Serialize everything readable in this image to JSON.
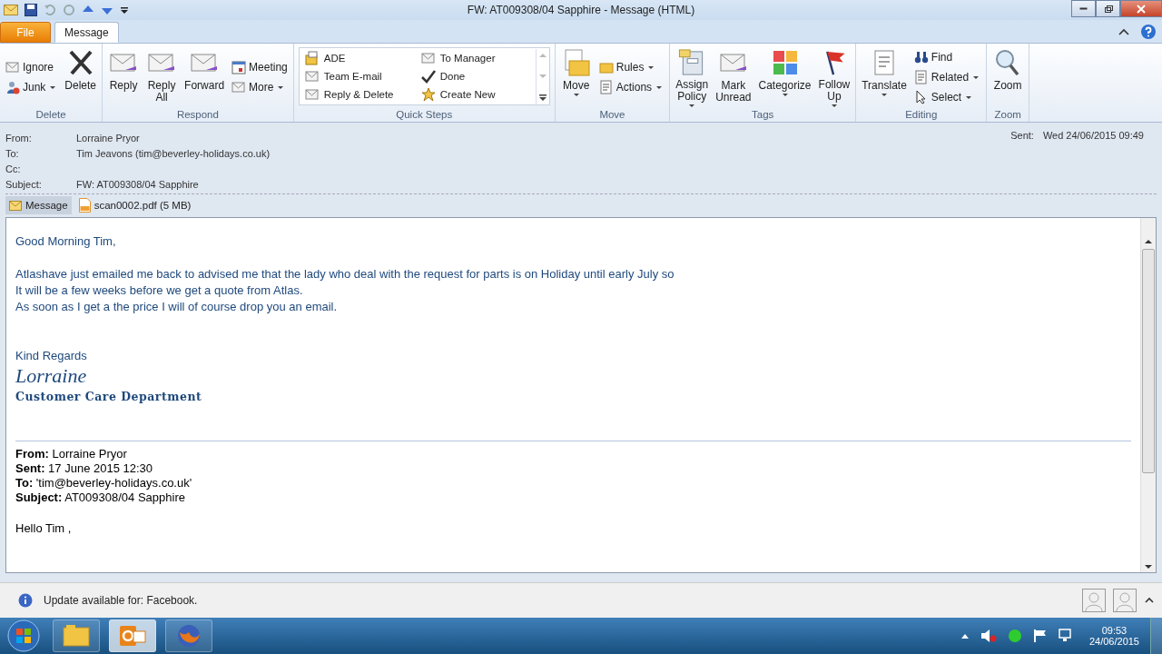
{
  "window": {
    "title": "FW: AT009308/04 Sapphire  -  Message (HTML)"
  },
  "tabs": [
    {
      "label": "File",
      "kind": "file",
      "selected": false
    },
    {
      "label": "Message",
      "kind": "tab",
      "selected": true
    }
  ],
  "ribbon": [
    {
      "name": "Delete",
      "columns": [
        [
          {
            "kind": "small",
            "label": "Ignore",
            "dropdown": false
          },
          {
            "kind": "small",
            "label": "Junk",
            "dropdown": true
          }
        ],
        [
          {
            "kind": "large",
            "label": "Delete",
            "dropdown": false
          }
        ]
      ]
    },
    {
      "name": "Respond",
      "columns": [
        [
          {
            "kind": "large",
            "label": "Reply",
            "dropdown": false
          }
        ],
        [
          {
            "kind": "large",
            "label": "Reply All",
            "dropdown": false
          }
        ],
        [
          {
            "kind": "large",
            "label": "Forward",
            "dropdown": false
          }
        ],
        [
          {
            "kind": "small",
            "label": "Meeting",
            "dropdown": false
          },
          {
            "kind": "small",
            "label": "More",
            "dropdown": true
          }
        ]
      ]
    },
    {
      "name": "Quick Steps",
      "columns": [
        [
          {
            "kind": "gallery",
            "label": "ADE"
          },
          {
            "kind": "gallery",
            "label": "Team E-mail"
          },
          {
            "kind": "gallery",
            "label": "Reply & Delete"
          }
        ],
        [
          {
            "kind": "gallery",
            "label": "To Manager"
          },
          {
            "kind": "gallery",
            "label": "Done"
          },
          {
            "kind": "gallery",
            "label": "Create New"
          }
        ]
      ]
    },
    {
      "name": "Move",
      "columns": [
        [
          {
            "kind": "large",
            "label": "Move",
            "dropdown": true
          }
        ],
        [
          {
            "kind": "small",
            "label": "Rules",
            "dropdown": true
          },
          {
            "kind": "small",
            "label": "Actions",
            "dropdown": true
          }
        ]
      ]
    },
    {
      "name": "Tags",
      "columns": [
        [
          {
            "kind": "large",
            "label": "Assign Policy",
            "dropdown": true
          }
        ],
        [
          {
            "kind": "large",
            "label": "Mark Unread",
            "dropdown": false
          }
        ],
        [
          {
            "kind": "large",
            "label": "Categorize",
            "dropdown": true
          }
        ],
        [
          {
            "kind": "large",
            "label": "Follow Up",
            "dropdown": true
          }
        ]
      ]
    },
    {
      "name": "Editing",
      "columns": [
        [
          {
            "kind": "large",
            "label": "Translate",
            "dropdown": true
          }
        ],
        [
          {
            "kind": "small",
            "label": "Find",
            "dropdown": false
          },
          {
            "kind": "small",
            "label": "Related",
            "dropdown": true
          },
          {
            "kind": "small",
            "label": "Select",
            "dropdown": true
          }
        ]
      ]
    },
    {
      "name": "Zoom",
      "columns": [
        [
          {
            "kind": "large",
            "label": "Zoom",
            "dropdown": false
          }
        ]
      ]
    }
  ],
  "header": {
    "fields": [
      {
        "label": "From:",
        "value": "Lorraine Pryor"
      },
      {
        "label": "To:",
        "value": "Tim Jeavons (tim@beverley-holidays.co.uk)"
      },
      {
        "label": "Cc:"
      },
      {
        "label": "Subject:",
        "value": "FW: AT009308/04 Sapphire"
      }
    ],
    "sent_label": "Sent:",
    "sent_value": "Wed 24/06/2015 09:49"
  },
  "attachments": [
    {
      "label": "Message",
      "kind": "message",
      "selected": true
    },
    {
      "label": "scan0002.pdf (5 MB)",
      "kind": "pdf",
      "selected": false
    }
  ],
  "body": [
    {
      "kind": "text",
      "text": "Good Morning Tim,"
    },
    {
      "kind": "gap"
    },
    {
      "kind": "text",
      "text": "Atlashave just emailed me back to advised me that the lady who deal with the request for parts is on Holiday until early July so"
    },
    {
      "kind": "text",
      "text": "It will be a few weeks before we get a quote from Atlas."
    },
    {
      "kind": "text",
      "text": "As soon as I get a the price I will of course drop you an email."
    },
    {
      "kind": "gap"
    },
    {
      "kind": "gap"
    },
    {
      "kind": "text",
      "text": "Kind Regards"
    },
    {
      "kind": "signature",
      "text": "Lorraine"
    },
    {
      "kind": "department",
      "text": "Customer Care Department"
    },
    {
      "kind": "gap"
    },
    {
      "kind": "gap"
    },
    {
      "kind": "rule"
    },
    {
      "kind": "meta",
      "label": "From:",
      "text": "Lorraine Pryor"
    },
    {
      "kind": "meta",
      "label": "Sent:",
      "text": "17 June 2015 12:30"
    },
    {
      "kind": "meta",
      "label": "To:",
      "text": "'tim@beverley-holidays.co.uk'"
    },
    {
      "kind": "meta",
      "label": "Subject:",
      "text": "AT009308/04 Sapphire"
    },
    {
      "kind": "gap"
    },
    {
      "kind": "plain",
      "text": "Hello Tim ,"
    }
  ],
  "notification": {
    "text": "Update available for: Facebook."
  },
  "taskbar": {
    "apps": [
      {
        "kind": "explorer",
        "selected": false
      },
      {
        "kind": "outlook",
        "selected": true
      },
      {
        "kind": "firefox",
        "selected": false
      }
    ],
    "time": "09:53",
    "date": "24/06/2015"
  }
}
